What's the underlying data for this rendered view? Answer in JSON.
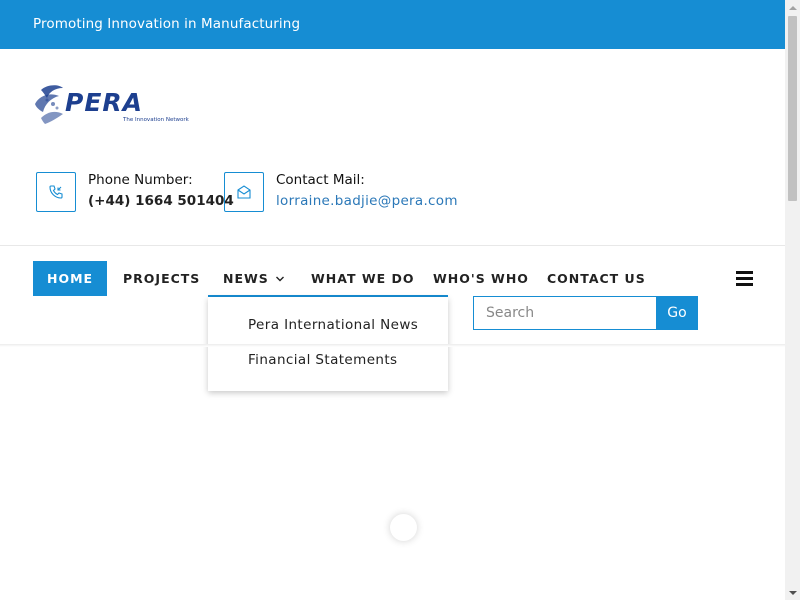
{
  "topbar": {
    "tagline": "Promoting Innovation in Manufacturing"
  },
  "logo": {
    "name": "PERA",
    "tagline": "The Innovation Network",
    "icon": "pera-globe-logo",
    "color": "#1d3f8f"
  },
  "contact": {
    "phone": {
      "label": "Phone Number:",
      "value": "(+44) 1664 501404",
      "icon": "phone-icon"
    },
    "mail": {
      "label": "Contact Mail:",
      "value": "lorraine.badjie@pera.com",
      "icon": "mail-icon"
    }
  },
  "nav": {
    "items": [
      {
        "label": "HOME",
        "active": true
      },
      {
        "label": "PROJECTS"
      },
      {
        "label": "NEWS",
        "has_dropdown": true
      },
      {
        "label": "WHAT WE DO"
      },
      {
        "label": "WHO'S WHO"
      },
      {
        "label": "CONTACT US"
      }
    ],
    "news_dropdown": [
      "Pera International News",
      "Financial Statements"
    ],
    "menu_icon": "hamburger-icon"
  },
  "search": {
    "placeholder": "Search",
    "button_label": "Go"
  },
  "colors": {
    "accent": "#168dd3",
    "link": "#2b78b8",
    "text": "#222222"
  }
}
